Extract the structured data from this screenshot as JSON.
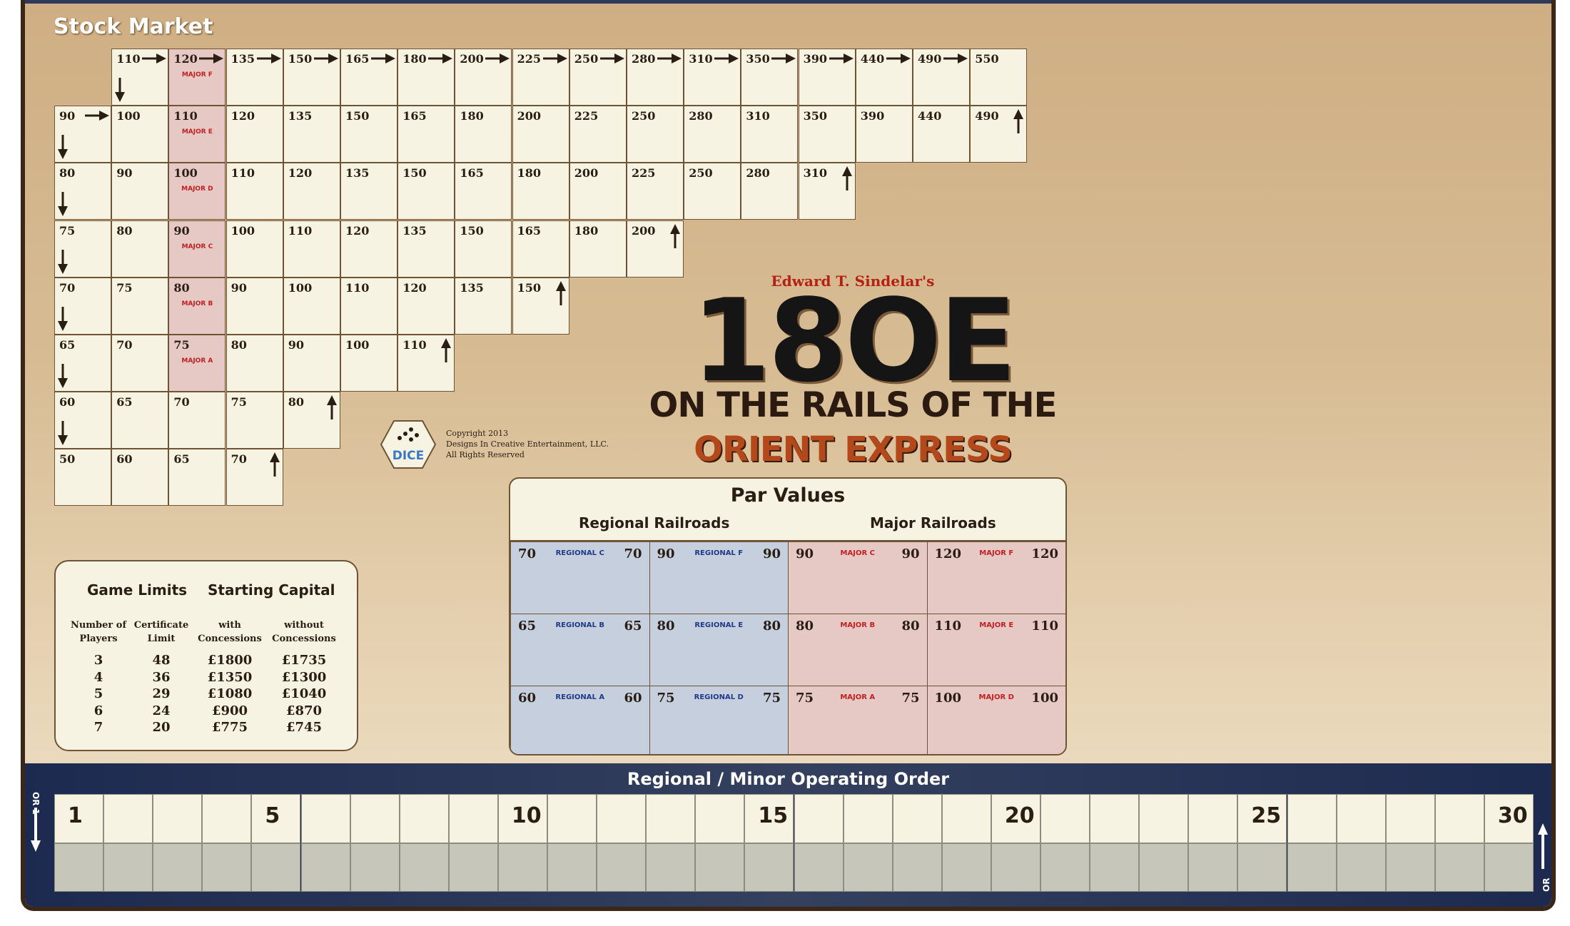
{
  "title": "Stock Market",
  "market": {
    "rows": [
      {
        "start": 1,
        "values": [
          "110",
          "120",
          "135",
          "150",
          "165",
          "180",
          "200",
          "225",
          "250",
          "280",
          "310",
          "350",
          "390",
          "440",
          "490",
          "550"
        ]
      },
      {
        "start": 0,
        "values": [
          "90",
          "100",
          "110",
          "120",
          "135",
          "150",
          "165",
          "180",
          "200",
          "225",
          "250",
          "280",
          "310",
          "350",
          "390",
          "440",
          "490"
        ]
      },
      {
        "start": 0,
        "values": [
          "80",
          "90",
          "100",
          "110",
          "120",
          "135",
          "150",
          "165",
          "180",
          "200",
          "225",
          "250",
          "280",
          "310"
        ]
      },
      {
        "start": 0,
        "values": [
          "75",
          "80",
          "90",
          "100",
          "110",
          "120",
          "135",
          "150",
          "165",
          "180",
          "200"
        ]
      },
      {
        "start": 0,
        "values": [
          "70",
          "75",
          "80",
          "90",
          "100",
          "110",
          "120",
          "135",
          "150"
        ]
      },
      {
        "start": 0,
        "values": [
          "65",
          "70",
          "75",
          "80",
          "90",
          "100",
          "110"
        ]
      },
      {
        "start": 0,
        "values": [
          "60",
          "65",
          "70",
          "75",
          "80"
        ]
      },
      {
        "start": 0,
        "values": [
          "50",
          "60",
          "65",
          "70"
        ]
      }
    ],
    "par_labels": [
      "MAJOR F",
      "MAJOR E",
      "MAJOR D",
      "MAJOR C",
      "MAJOR B",
      "MAJOR A"
    ]
  },
  "logo": {
    "author": "Edward T. Sindelar's",
    "title": "18OE",
    "line1": "ON THE RAILS OF THE",
    "line2": "ORIENT EXPRESS",
    "dice_label": "DICE"
  },
  "copyright": [
    "Copyright 2013",
    "Designs In Creative Entertainment, LLC.",
    "All Rights Reserved"
  ],
  "limits": {
    "title_left": "Game Limits",
    "title_right": "Starting Capital",
    "headers": [
      [
        "Number of",
        "Players"
      ],
      [
        "Certificate",
        "Limit"
      ],
      [
        "with",
        "Concessions"
      ],
      [
        "without",
        "Concessions"
      ]
    ],
    "rows": [
      [
        "3",
        "48",
        "£1800",
        "£1735"
      ],
      [
        "4",
        "36",
        "£1350",
        "£1300"
      ],
      [
        "5",
        "29",
        "£1080",
        "£1040"
      ],
      [
        "6",
        "24",
        "£900",
        "£870"
      ],
      [
        "7",
        "20",
        "£775",
        "£745"
      ]
    ]
  },
  "par": {
    "title": "Par Values",
    "regional_label": "Regional Railroads",
    "major_label": "Major Railroads",
    "rows": [
      [
        {
          "v": "70",
          "n": "REGIONAL C",
          "k": "reg"
        },
        {
          "v": "90",
          "n": "REGIONAL F",
          "k": "reg"
        },
        {
          "v": "90",
          "n": "MAJOR C",
          "k": "maj"
        },
        {
          "v": "120",
          "n": "MAJOR F",
          "k": "maj"
        }
      ],
      [
        {
          "v": "65",
          "n": "REGIONAL B",
          "k": "reg"
        },
        {
          "v": "80",
          "n": "REGIONAL E",
          "k": "reg"
        },
        {
          "v": "80",
          "n": "MAJOR B",
          "k": "maj"
        },
        {
          "v": "110",
          "n": "MAJOR E",
          "k": "maj"
        }
      ],
      [
        {
          "v": "60",
          "n": "REGIONAL A",
          "k": "reg"
        },
        {
          "v": "75",
          "n": "REGIONAL D",
          "k": "reg"
        },
        {
          "v": "75",
          "n": "MAJOR A",
          "k": "maj"
        },
        {
          "v": "100",
          "n": "MAJOR D",
          "k": "maj"
        }
      ]
    ]
  },
  "operating": {
    "title": "Regional / Minor Operating Order",
    "numbers": [
      "1",
      "5",
      "10",
      "15",
      "20",
      "25",
      "30"
    ],
    "or1": "OR 1",
    "or2": "OR 2"
  },
  "colors": {
    "major": "#c32021",
    "regional": "#203a8a",
    "par_major_bg": "#e6c9c5",
    "par_regional_bg": "#c5cfde",
    "op_bar": "#1d2a50"
  }
}
